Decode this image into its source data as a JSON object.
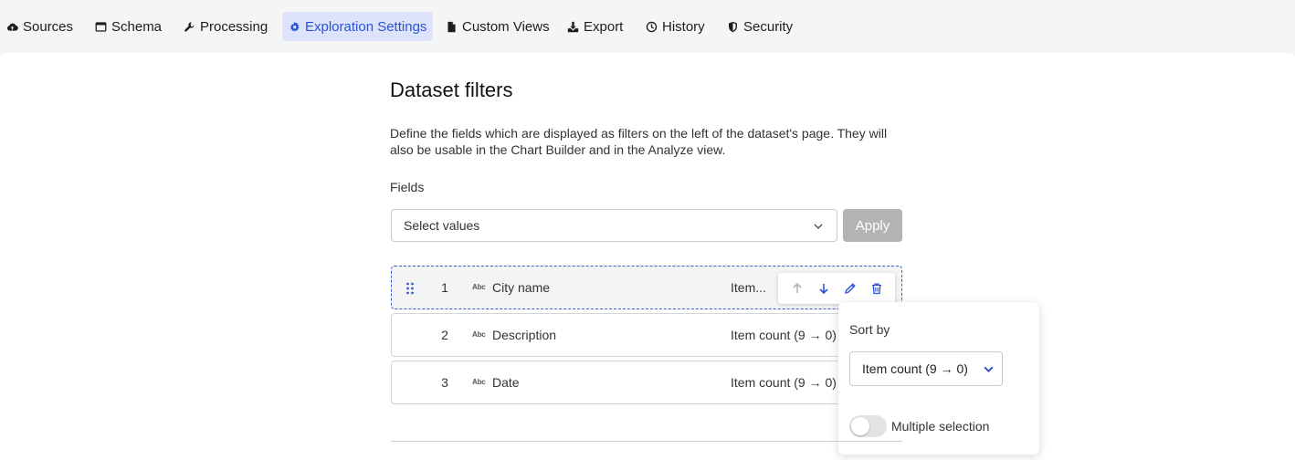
{
  "nav": {
    "tabs": [
      {
        "label": "Sources",
        "icon": "cloud-upload-icon"
      },
      {
        "label": "Schema",
        "icon": "window-icon"
      },
      {
        "label": "Processing",
        "icon": "wrench-icon"
      },
      {
        "label": "Exploration Settings",
        "icon": "gear-icon",
        "active": true
      },
      {
        "label": "Custom Views",
        "icon": "file-icon"
      },
      {
        "label": "Export",
        "icon": "download-icon"
      },
      {
        "label": "History",
        "icon": "clock-icon"
      },
      {
        "label": "Security",
        "icon": "shield-icon"
      }
    ]
  },
  "page": {
    "title": "Dataset filters",
    "description": "Define the fields which are displayed as filters on the left of the dataset's page. They will also be usable in the Chart Builder and in the Analyze view.",
    "fields_label": "Fields",
    "select_placeholder": "Select values",
    "apply_label": "Apply"
  },
  "filters": [
    {
      "index": "1",
      "type": "Abc",
      "name": "City name",
      "sort": "Item..."
    },
    {
      "index": "2",
      "type": "Abc",
      "name": "Description",
      "sort": "Item count (9 → 0)"
    },
    {
      "index": "3",
      "type": "Abc",
      "name": "Date",
      "sort": "Item count (9 → 0)"
    }
  ],
  "popover": {
    "sort_label": "Sort by",
    "sort_value": "Item count (9 → 0)",
    "multiple_label": "Multiple selection",
    "multiple_enabled": false
  },
  "colors": {
    "accent": "#2b52d6",
    "active_tab_bg": "#dde3fb",
    "apply_disabled": "#b3b3b3"
  }
}
